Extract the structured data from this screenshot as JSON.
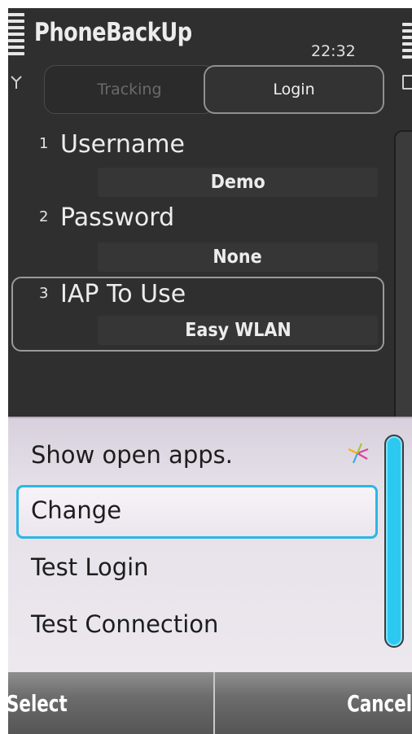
{
  "app": {
    "title": "PhoneBackUp",
    "clock": "22:32"
  },
  "tabs": [
    {
      "label": "Tracking",
      "active": false
    },
    {
      "label": "Login",
      "active": true
    }
  ],
  "settings": [
    {
      "number": "1",
      "label": "Username",
      "value": "Demo"
    },
    {
      "number": "2",
      "label": "Password",
      "value": "None"
    },
    {
      "number": "3",
      "label": "IAP To Use",
      "value": "Easy WLAN"
    }
  ],
  "menu": {
    "items": [
      {
        "label": "Show open apps."
      },
      {
        "label": "Change",
        "selected": true
      },
      {
        "label": "Test Login"
      },
      {
        "label": "Test Connection"
      }
    ]
  },
  "softkeys": {
    "left": "Select",
    "right": "Cancel"
  },
  "icons": {
    "signal": "signal-strength-icon",
    "antenna": "antenna-icon",
    "battery": "battery-level-icon",
    "sparkle": "task-switcher-icon"
  },
  "colors": {
    "accent": "#2bb7e3",
    "scrollbar": "#2cc8ef",
    "background_dark": "#2f2f2f",
    "popup_bg": "#e6e1e9"
  }
}
